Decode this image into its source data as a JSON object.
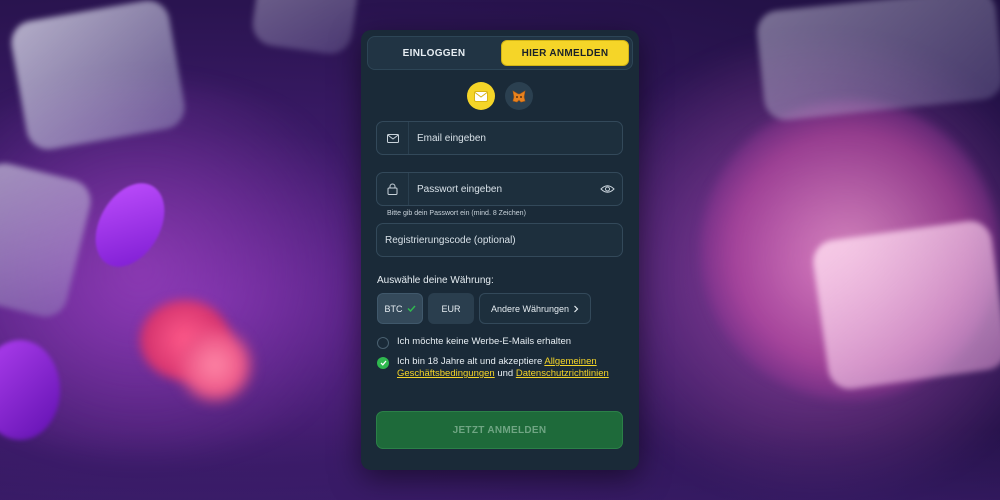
{
  "tabs": {
    "login": "EINLOGGEN",
    "register": "HIER ANMELDEN"
  },
  "methods": [
    {
      "icon": "email-icon",
      "active": true
    },
    {
      "icon": "metamask-icon",
      "active": false
    }
  ],
  "form": {
    "email_placeholder": "Email eingeben",
    "password_placeholder": "Passwort eingeben",
    "password_hint": "Bitte gib dein Passwort ein (mind. 8 Zeichen)",
    "referral_placeholder": "Registrierungscode (optional)"
  },
  "currency": {
    "label": "Auswähle deine Währung:",
    "options": [
      "BTC",
      "EUR"
    ],
    "selected": "BTC",
    "other_label": "Andere Währungen"
  },
  "consents": {
    "no_emails": "Ich möchte keine Werbe-E-Mails erhalten",
    "age_prefix": "Ich bin 18 Jahre alt und akzeptiere",
    "terms_link": "Allgemeinen Geschäftsbedingungen",
    "and": "und",
    "privacy_link": "Datenschutzrichtlinien"
  },
  "submit_label": "JETZT ANMELDEN",
  "colors": {
    "accent_yellow": "#f5d528",
    "submit_green": "#1e6a3a",
    "check_green": "#2fb84f",
    "panel_bg": "#1a2a38"
  }
}
